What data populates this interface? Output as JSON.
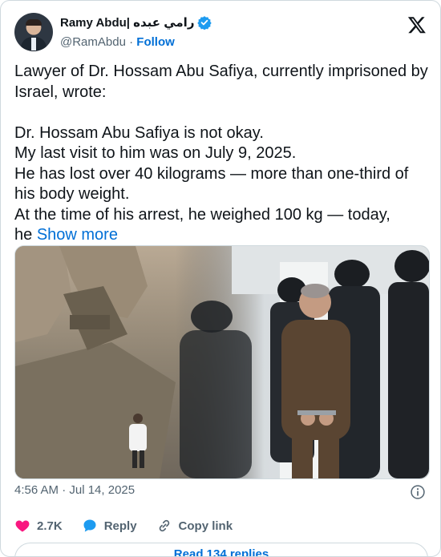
{
  "author": {
    "display_name": "Ramy Abdu| رامي عبده",
    "handle": "@RamAbdu",
    "separator": "·",
    "follow_label": "Follow"
  },
  "tweet": {
    "lines": [
      "Lawyer of Dr. Hossam Abu Safiya, currently imprisoned by Israel, wrote:",
      "",
      "Dr. Hossam Abu Safiya is not okay.",
      "My last visit to him was on July 9, 2025.",
      "He has lost over 40 kilograms — more than one-third of his body weight.",
      "At the time of his arrest, he weighed 100 kg — today,"
    ],
    "last_line_start": "he",
    "show_more": "Show more"
  },
  "meta": {
    "timestamp": "4:56 AM · Jul 14, 2025"
  },
  "actions": {
    "like_count": "2.7K",
    "reply_label": "Reply",
    "copy_link_label": "Copy link"
  },
  "replies_label": "Read 134 replies",
  "colors": {
    "link": "#006fd6",
    "like": "#f91880",
    "verified": "#1d9bf0",
    "secondary_text": "#536471"
  }
}
